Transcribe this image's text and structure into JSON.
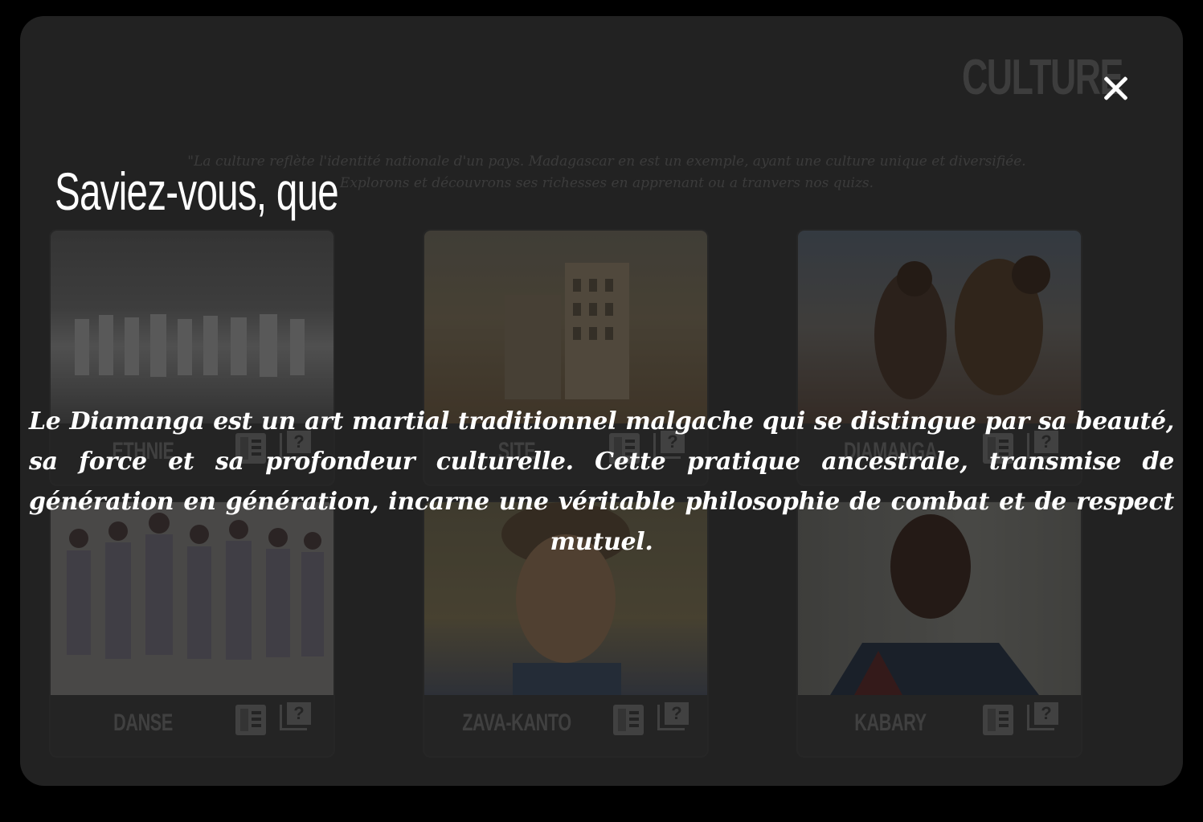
{
  "panel": {
    "title": "CULTURE",
    "intro": "\"La culture reflète l'identité nationale d'un pays. Madagascar en est un exemple, ayant une culture unique et diversifiée. Explorons et découvrons ses richesses en apprenant ou a tranvers nos quizs."
  },
  "cards": [
    {
      "label": "ETHNIE",
      "book_icon": "book-icon",
      "quiz_icon": "quiz-icon"
    },
    {
      "label": "SITE",
      "book_icon": "book-icon",
      "quiz_icon": "quiz-icon"
    },
    {
      "label": "DIAMANGA",
      "book_icon": "book-icon",
      "quiz_icon": "quiz-icon"
    },
    {
      "label": "DANSE",
      "book_icon": "book-icon",
      "quiz_icon": "quiz-icon"
    },
    {
      "label": "ZAVA-KANTO",
      "book_icon": "book-icon",
      "quiz_icon": "quiz-icon"
    },
    {
      "label": "KABARY",
      "book_icon": "book-icon",
      "quiz_icon": "quiz-icon"
    }
  ],
  "quiz_icon_glyph": "?",
  "modal": {
    "heading": "Saviez-vous, que",
    "text": "Le Diamanga est un art martial traditionnel malgache qui se distingue par sa beauté, sa force et sa profondeur culturelle. Cette pratique ancestrale, transmise de génération en génération, incarne une véritable philosophie de combat et de respect mutuel.",
    "close_icon": "close-icon"
  },
  "colors": {
    "page_background": "#000000",
    "panel_background": "#3b3b3b",
    "modal_text": "#ffffff"
  }
}
